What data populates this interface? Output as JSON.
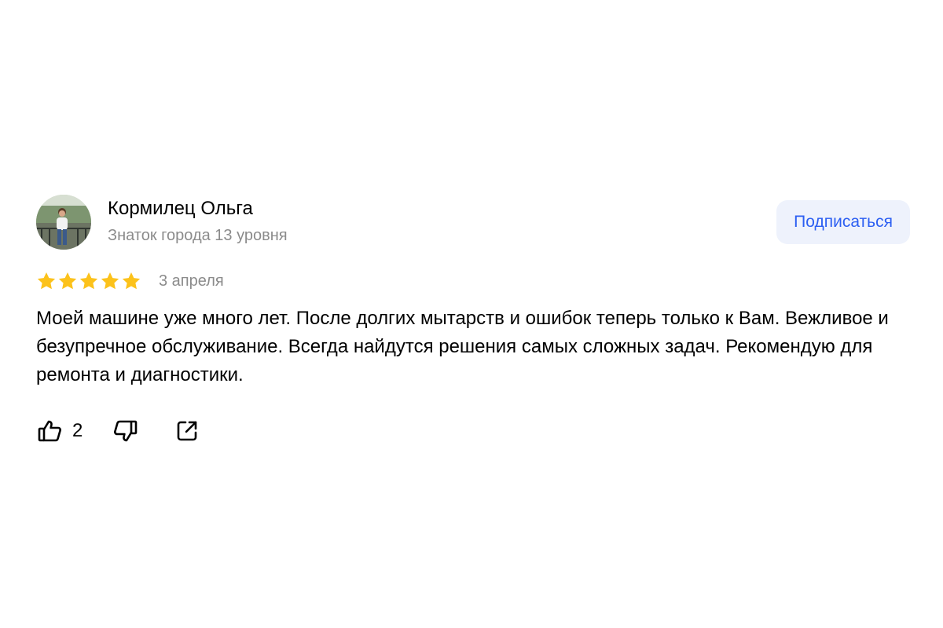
{
  "review": {
    "author": {
      "name": "Кормилец Ольга",
      "level": "Знаток города 13 уровня",
      "avatar_icon": "user-photo"
    },
    "subscribe_label": "Подписаться",
    "rating": 5,
    "rating_max": 5,
    "date": "3 апреля",
    "text": "Моей машине уже много лет. После долгих мытарств и ошибок теперь только к Вам. Вежливое и безупречное обслуживание. Всегда найдутся решения самых сложных задач. Рекомендую для ремонта и диагностики.",
    "actions": {
      "like_icon": "thumb-up-icon",
      "like_count": "2",
      "dislike_icon": "thumb-down-icon",
      "share_icon": "share-icon"
    }
  },
  "colors": {
    "star": "#fcc21b",
    "accent": "#2c5ff2",
    "button_bg": "#eef2fc",
    "secondary_text": "#8b8b8b"
  }
}
